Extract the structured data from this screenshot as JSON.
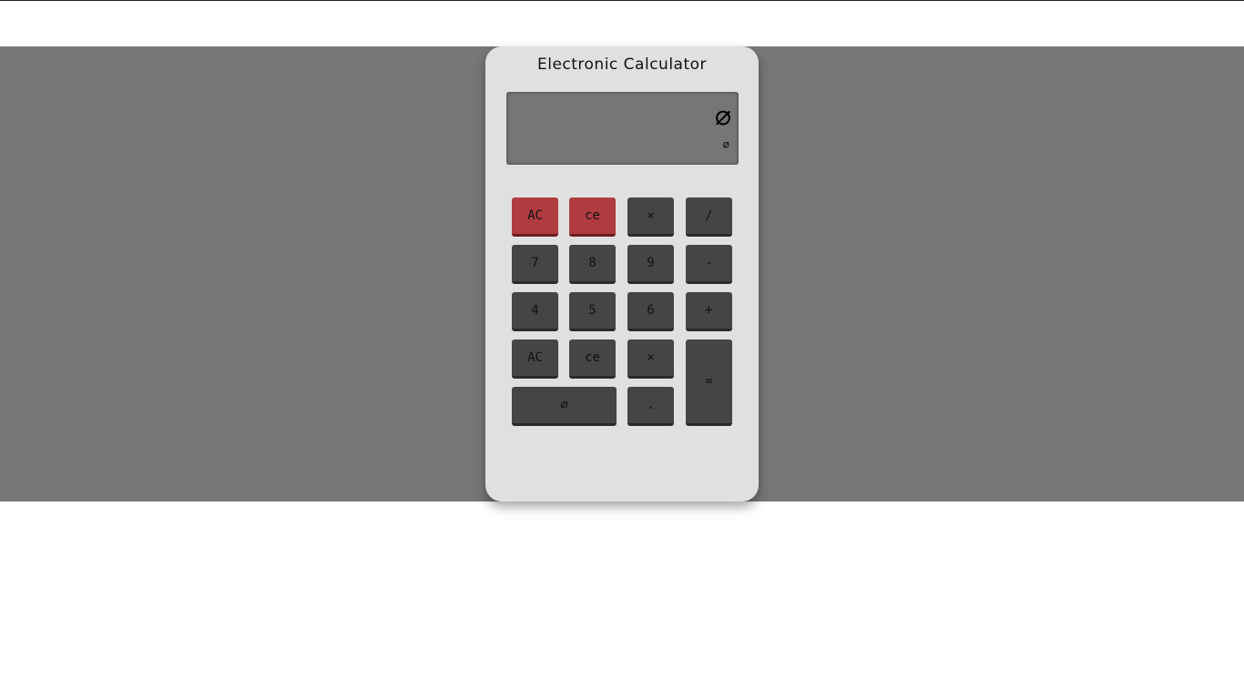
{
  "calculator": {
    "title": "Electronic Calculator",
    "display": {
      "main": "∅",
      "sub": "∅"
    },
    "colors": {
      "band": "#777777",
      "body": "#e0e0e0",
      "display": "#767676",
      "key": "#454545",
      "key_red": "#b03c40"
    },
    "keys": {
      "ac_top": "AC",
      "ce_top": "ce",
      "multiply_top": "×",
      "divide": "/",
      "seven": "7",
      "eight": "8",
      "nine": "9",
      "minus": "-",
      "four": "4",
      "five": "5",
      "six": "6",
      "plus": "+",
      "ac_bottom": "AC",
      "ce_bottom": "ce",
      "multiply_bottom": "×",
      "equals": "=",
      "zero": "∅",
      "decimal": "."
    }
  }
}
